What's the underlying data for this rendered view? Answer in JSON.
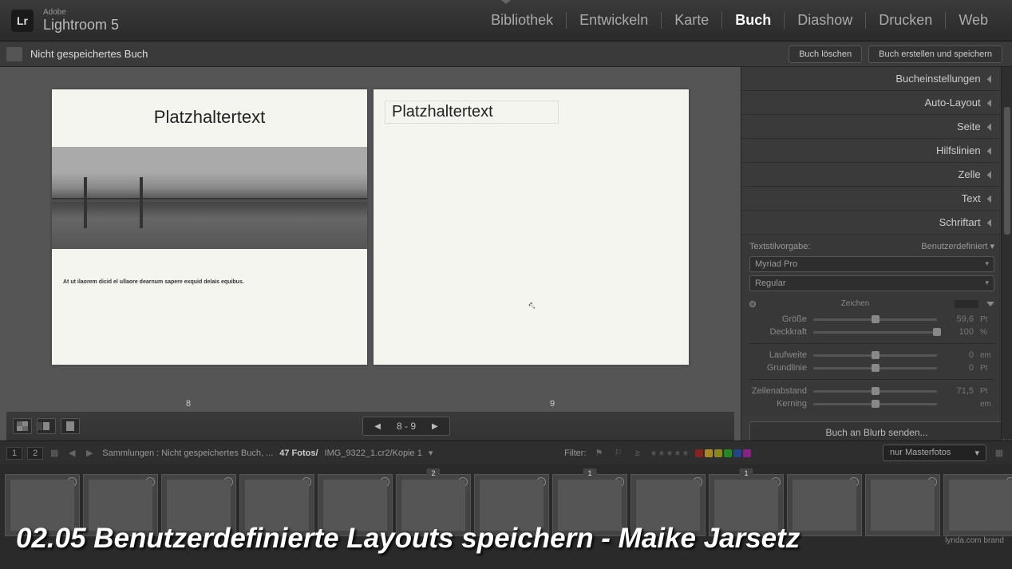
{
  "brand": {
    "adobe": "Adobe",
    "name": "Lightroom 5",
    "logo": "Lr"
  },
  "modules": [
    "Bibliothek",
    "Entwickeln",
    "Karte",
    "Buch",
    "Diashow",
    "Drucken",
    "Web"
  ],
  "activeModule": 3,
  "subbar": {
    "title": "Nicht gespeichertes Buch",
    "btn_clear": "Buch löschen",
    "btn_save": "Buch erstellen und speichern"
  },
  "spread": {
    "left": {
      "title": "Platzhaltertext",
      "caption": "At ut ilaorem dicid el ullaore dearnum sapere exquid delais equibus."
    },
    "right": {
      "title": "Platzhaltertext"
    },
    "page_left": "8",
    "page_right": "9"
  },
  "navigator": {
    "pages": "8  -  9"
  },
  "right_panel": {
    "sections": [
      "Bucheinstellungen",
      "Auto-Layout",
      "Seite",
      "Hilfslinien",
      "Zelle",
      "Text",
      "Schriftart"
    ],
    "textstil_label": "Textstilvorgabe:",
    "textstil_value": "Benutzerdefiniert",
    "font": "Myriad Pro",
    "font_weight": "Regular",
    "zeichen": "Zeichen",
    "sliders": [
      {
        "label": "Größe",
        "val": "59,6",
        "unit": "Pt",
        "pos": 50
      },
      {
        "label": "Deckkraft",
        "val": "100",
        "unit": "%",
        "pos": 100
      },
      {
        "label": "Laufweite",
        "val": "0",
        "unit": "em",
        "pos": 50
      },
      {
        "label": "Grundlinie",
        "val": "0",
        "unit": "Pt",
        "pos": 50
      },
      {
        "label": "Zeilenabstand",
        "val": "71,5",
        "unit": "Pt",
        "pos": 50
      },
      {
        "label": "Kerning",
        "val": "",
        "unit": "em",
        "pos": 50
      }
    ],
    "send_btn": "Buch an Blurb senden..."
  },
  "filter_bar": {
    "nums": [
      "1",
      "2"
    ],
    "collection": "Sammlungen : Nicht gespeichertes Buch, ...",
    "count": "47 Fotos/",
    "file": "IMG_9322_1.cr2/Kopie 1",
    "filter_label": "Filter:",
    "filter_select": "nur Masterfotos"
  },
  "filmstrip": [
    {
      "cls": "fs1"
    },
    {
      "cls": "fs2"
    },
    {
      "cls": "fs3"
    },
    {
      "cls": "fs4"
    },
    {
      "cls": "fs5"
    },
    {
      "cls": "fs6",
      "badge": "2"
    },
    {
      "cls": "fs7"
    },
    {
      "cls": "fs8",
      "badge": "1"
    },
    {
      "cls": "fs9"
    },
    {
      "cls": "fs10",
      "badge": "1"
    },
    {
      "cls": "fs11"
    },
    {
      "cls": "fs12"
    },
    {
      "cls": "fs13"
    }
  ],
  "overlay": "02.05 Benutzerdefinierte Layouts speichern - Maike Jarsetz",
  "watermark": "lynda.com brand"
}
